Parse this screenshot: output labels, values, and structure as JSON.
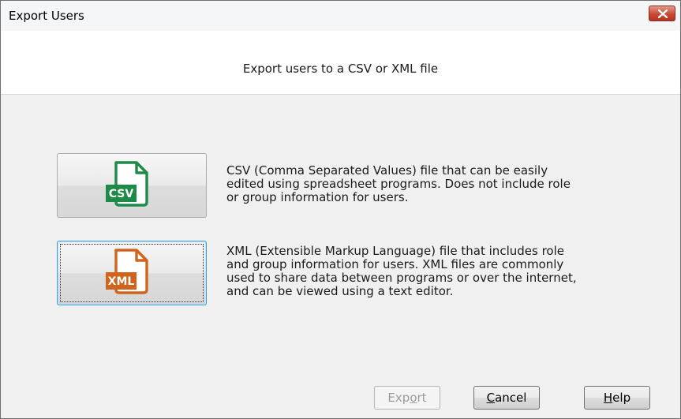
{
  "window": {
    "title": "Export Users",
    "close_icon": "close-x-icon"
  },
  "header": {
    "text": "Export users to a CSV or XML file"
  },
  "options": [
    {
      "id": "csv",
      "icon": "csv-file-icon",
      "icon_label": "CSV",
      "icon_color": "#1e8a47",
      "desc_lines": [
        "CSV (Comma Separated Values) file that can be easily",
        "edited using spreadsheet programs. Does not include role",
        "or group information for users."
      ]
    },
    {
      "id": "xml",
      "icon": "xml-file-icon",
      "icon_label": "XML",
      "icon_color": "#d1641c",
      "focused": true,
      "desc_lines": [
        "XML (Extensible Markup Language) file that includes role",
        "and group information for users. XML files are commonly",
        "used to share data between programs or over the internet,",
        "and can be viewed using a text editor."
      ]
    }
  ],
  "footer": {
    "export": {
      "pre": "Exp",
      "mnemonic": "o",
      "post": "rt",
      "disabled": true
    },
    "cancel": {
      "pre": "",
      "mnemonic": "C",
      "post": "ancel"
    },
    "help": {
      "pre": "",
      "mnemonic": "H",
      "post": "elp"
    }
  }
}
